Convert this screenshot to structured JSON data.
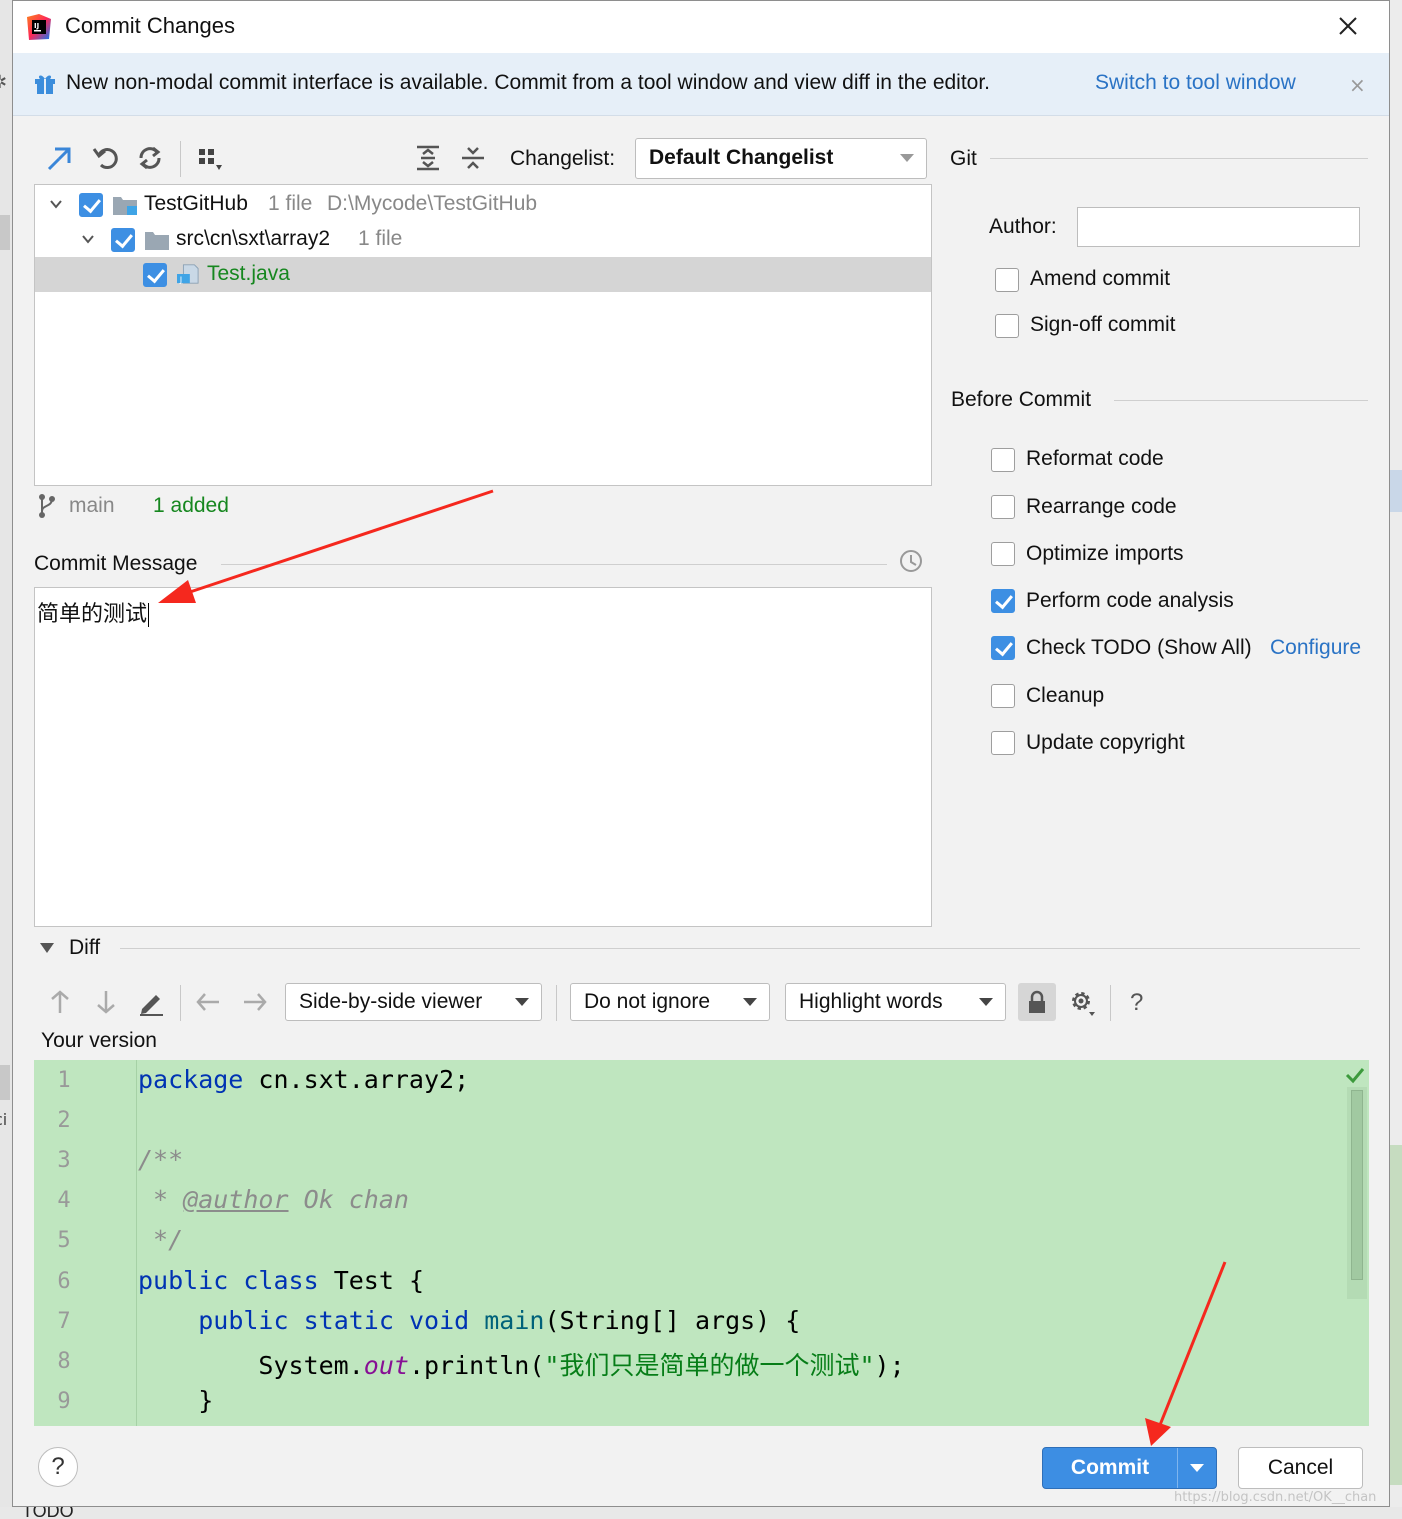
{
  "dialog": {
    "title": "Commit Changes",
    "app_icon": "intellij-idea-icon",
    "close_icon": "close-icon"
  },
  "banner": {
    "text": "New non-modal commit interface is available. Commit from a tool window and view diff in the editor.",
    "link": "Switch to tool window",
    "close": "×"
  },
  "changes": {
    "toolbar_icons": [
      "move-to-changelist-icon",
      "rollback-icon",
      "refresh-icon",
      "group-by-icon",
      "expand-all-icon",
      "collapse-all-icon"
    ],
    "changelist_label": "Changelist:",
    "changelist_value": "Default Changelist",
    "tree": [
      {
        "name": "TestGitHub",
        "count": "1 file",
        "path": "D:\\Mycode\\TestGitHub",
        "checked": true
      },
      {
        "name": "src\\cn\\sxt\\array2",
        "count": "1 file",
        "checked": true
      },
      {
        "name": "Test.java",
        "checked": true,
        "status": "added"
      }
    ],
    "branch": "main",
    "summary": "1 added"
  },
  "commit_message": {
    "label": "Commit Message",
    "text": "简单的测试",
    "history_icon": "clock-icon"
  },
  "git": {
    "section": "Git",
    "author_label": "Author:",
    "author_value": "",
    "amend_label": "Amend commit",
    "amend_checked": false,
    "signoff_label": "Sign-off commit",
    "signoff_checked": false
  },
  "before_commit": {
    "section": "Before Commit",
    "options": [
      {
        "label": "Reformat code",
        "checked": false
      },
      {
        "label": "Rearrange code",
        "checked": false
      },
      {
        "label": "Optimize imports",
        "checked": false
      },
      {
        "label": "Perform code analysis",
        "checked": true
      },
      {
        "label": "Check TODO (Show All)",
        "checked": true,
        "link": "Configure"
      },
      {
        "label": "Cleanup",
        "checked": false
      },
      {
        "label": "Update copyright",
        "checked": false
      }
    ]
  },
  "diff": {
    "section": "Diff",
    "viewer": "Side-by-side viewer",
    "ignore": "Do not ignore",
    "highlight": "Highlight words",
    "help": "?",
    "version_label": "Your version",
    "line_numbers": [
      "1",
      "2",
      "3",
      "4",
      "5",
      "6",
      "7",
      "8",
      "9"
    ],
    "code": [
      "package cn.sxt.array2;",
      "",
      "/**",
      " * @author Ok chan",
      " */",
      "public class Test {",
      "    public static void main(String[] args) {",
      "        System.out.println(\"我们只是简单的做一个测试\");",
      "    }"
    ]
  },
  "footer": {
    "help": "?",
    "commit": "Commit",
    "cancel": "Cancel"
  },
  "background": {
    "todo_tab": "TODO",
    "watermark": "https://blog.csdn.net/OK__chan"
  },
  "colors": {
    "accent": "#3d8ee3",
    "link": "#2a73c5",
    "diff_added_bg": "#bfe6bf",
    "added_file": "#16871f",
    "annotation_arrow": "#f5281e"
  }
}
